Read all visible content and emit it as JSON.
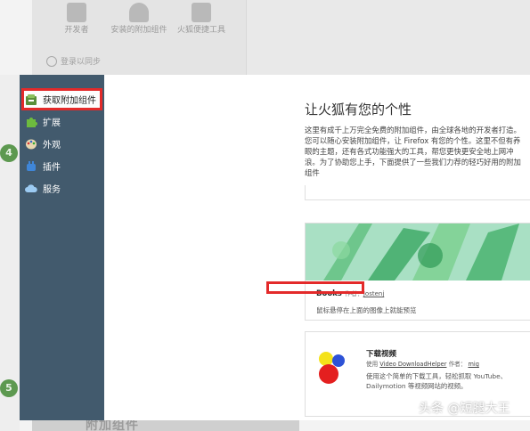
{
  "background_panel": {
    "tools": [
      {
        "label": "开发者",
        "icon": "wrench-icon"
      },
      {
        "label": "安装的附加组件",
        "icon": "person-icon"
      },
      {
        "label": "火狐便捷工具",
        "icon": "toolbox-icon"
      }
    ],
    "sync_label": "登录以同步",
    "steps": [
      "4",
      "5"
    ],
    "bottom_text": "附加组件"
  },
  "sidebar": {
    "items": [
      {
        "label": "获取附加组件",
        "icon": "get-addons-icon",
        "active": true
      },
      {
        "label": "扩展",
        "icon": "puzzle-icon"
      },
      {
        "label": "外观",
        "icon": "palette-icon"
      },
      {
        "label": "插件",
        "icon": "plugin-icon"
      },
      {
        "label": "服务",
        "icon": "cloud-icon"
      }
    ]
  },
  "main": {
    "title": "让火狐有您的个性",
    "description": "这里有成千上万完全免费的附加组件，由全球各地的开发者打造。您可以随心安装附加组件，让 Firefox 有您的个性。这里不但有养眼的主题，还有各式功能强大的工具，帮您更快更安全地上网冲浪。为了协助您上手，下面提供了一些我们力荐的轻巧好用的附加组件",
    "cards": [
      {
        "title": "Books",
        "author_prefix": "作者：",
        "author": "Jostenj",
        "description": "鼠标悬停在上面的图像上就能预览"
      },
      {
        "title": "下载视频",
        "meta_prefix": "使用",
        "addon_name": "Video DownloadHelper",
        "author_prefix": "作者：",
        "author": "mig",
        "description": "使用这个简单的下载工具，轻松抓取 YouTube、Dailymotion 等视频网站的视频。"
      }
    ]
  },
  "watermark": "头条 @短腿大王",
  "colors": {
    "sidebar": "#425a6d",
    "highlight": "#e32a2a",
    "banner": "#a7dfc0"
  }
}
